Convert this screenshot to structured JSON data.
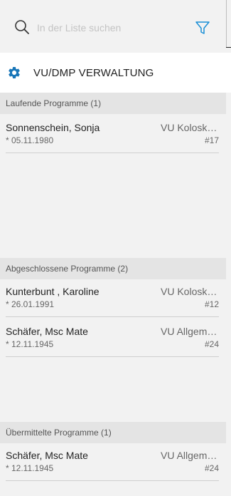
{
  "search": {
    "placeholder": "In der Liste suchen"
  },
  "header": {
    "title": "VU/DMP VERWALTUNG"
  },
  "sections": [
    {
      "title": "Laufende Programme (1)",
      "rows": [
        {
          "name": "Sonnenschein, Sonja",
          "program": "VU Koloskopie",
          "dob": "* 05.11.1980",
          "number": "#17"
        }
      ]
    },
    {
      "title": "Abgeschlossene Programme (2)",
      "rows": [
        {
          "name": "Kunterbunt , Karoline",
          "program": "VU Koloskopie",
          "dob": "* 26.01.1991",
          "number": "#12"
        },
        {
          "name": "Schäfer, Msc Mate",
          "program": "VU Allgemein",
          "dob": "* 12.11.1945",
          "number": "#24"
        }
      ]
    },
    {
      "title": "Übermittelte Programme (1)",
      "rows": [
        {
          "name": "Schäfer, Msc Mate",
          "program": "VU Allgemein",
          "dob": "* 12.11.1945",
          "number": "#24"
        }
      ]
    }
  ],
  "colors": {
    "accent": "#1a8fd6",
    "gear": "#1976b8"
  }
}
